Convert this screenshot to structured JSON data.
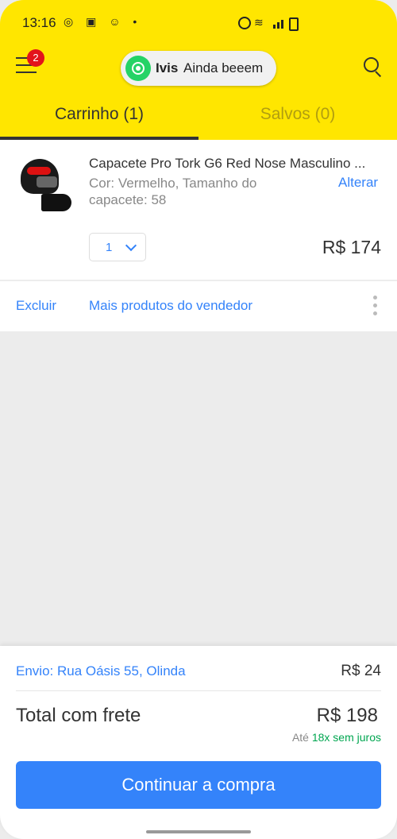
{
  "status_bar": {
    "time": "13:16",
    "left_icons": "◎ ▣ ☺ •"
  },
  "header": {
    "menu_badge": "2",
    "chat": {
      "name": "Ivis",
      "message": "Ainda beeem"
    },
    "tabs": [
      {
        "label": "Carrinho (1)"
      },
      {
        "label": "Salvos (0)"
      }
    ]
  },
  "cart": {
    "item": {
      "title": "Capacete Pro Tork G6 Red Nose Masculino ...",
      "variant": "Cor: Vermelho, Tamanho do capacete: 58",
      "change_label": "Alterar",
      "quantity": "1",
      "price": "R$ 174"
    },
    "actions": {
      "delete": "Excluir",
      "more": "Mais produtos do vendedor"
    }
  },
  "summary": {
    "shipping_address": "Envio: Rua Oásis 55, Olinda",
    "shipping_cost": "R$ 24",
    "total_label": "Total com frete",
    "total_value": "R$ 198",
    "installments_prefix": "Até",
    "installments_highlight": "18x sem juros",
    "cta_label": "Continuar a compra"
  },
  "colors": {
    "brand_yellow": "#ffe600",
    "link_blue": "#3483fa",
    "badge_red": "#e3131b",
    "whatsapp_green": "#25d366",
    "installment_green": "#00a650"
  }
}
